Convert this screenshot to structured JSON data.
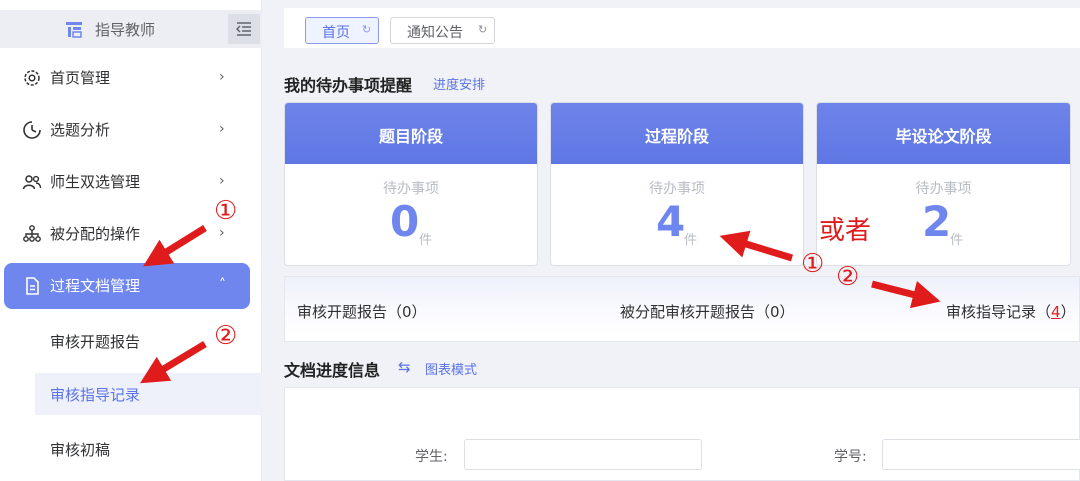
{
  "sidebar": {
    "role": "指导教师",
    "items": [
      {
        "label": "首页管理",
        "arrow": "›"
      },
      {
        "label": "选题分析",
        "arrow": "›"
      },
      {
        "label": "师生双选管理",
        "arrow": "›"
      },
      {
        "label": "被分配的操作",
        "arrow": "›"
      },
      {
        "label": "过程文档管理",
        "arrow": "˄"
      }
    ],
    "sub_items": [
      {
        "label": "审核开题报告"
      },
      {
        "label": "审核指导记录"
      },
      {
        "label": "审核初稿"
      }
    ]
  },
  "tabs": [
    {
      "label": "首页",
      "refresh": "↻"
    },
    {
      "label": "通知公告",
      "refresh": "↻"
    }
  ],
  "todo": {
    "title": "我的待办事项提醒",
    "link": "进度安排",
    "cards": [
      {
        "title": "题目阶段",
        "sub": "待办事项",
        "count": "0",
        "unit": "件"
      },
      {
        "title": "过程阶段",
        "sub": "待办事项",
        "count": "4",
        "unit": "件"
      },
      {
        "title": "毕设论文阶段",
        "sub": "待办事项",
        "count": "2",
        "unit": "件"
      }
    ]
  },
  "summary": {
    "item1": "审核开题报告（0）",
    "item2": "被分配审核开题报告（0）",
    "item3_prefix": "审核指导记录（",
    "item3_count": "4",
    "item3_suffix": "）"
  },
  "docs": {
    "title": "文档进度信息",
    "swap_icon": "⇆",
    "mode_link": "图表模式",
    "student_label": "学生:",
    "student_value": "",
    "student_id_label": "学号:",
    "student_id_value": ""
  },
  "annotations": {
    "or_text": "或者",
    "marks": [
      "①",
      "②",
      "①",
      "②"
    ],
    "color": "#e01b1b"
  },
  "colors": {
    "accent": "#6f86ee",
    "accent_text": "#5b73e8",
    "highlight_count": "#e02020"
  }
}
